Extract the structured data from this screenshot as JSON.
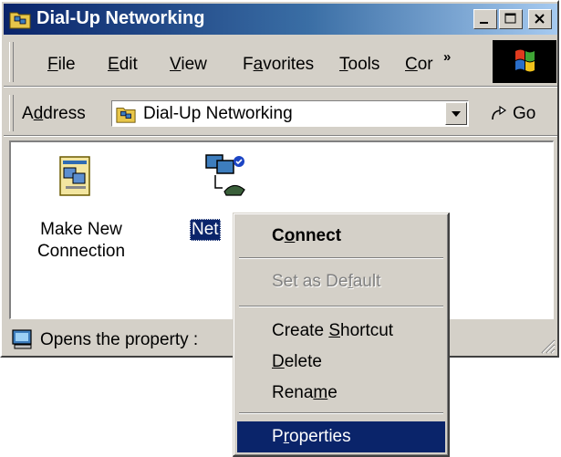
{
  "window": {
    "title": "Dial-Up Networking"
  },
  "menubar": {
    "items": [
      {
        "label": "File",
        "ul": "F",
        "rest": "ile"
      },
      {
        "label": "Edit",
        "ul": "E",
        "rest": "dit"
      },
      {
        "label": "View",
        "ul": "V",
        "rest": "iew"
      },
      {
        "label": "Favorites",
        "pre": "F",
        "ul": "a",
        "rest": "vorites"
      },
      {
        "label": "Tools",
        "ul": "T",
        "rest": "ools"
      },
      {
        "label": "Cor",
        "ul": "C",
        "rest": "or"
      }
    ],
    "chevron": "»"
  },
  "addressbar": {
    "label_pre": "A",
    "label_ul": "d",
    "label_rest": "dress",
    "value": "Dial-Up Networking",
    "go_label": "Go"
  },
  "content": {
    "items": [
      {
        "line1": "Make New",
        "line2": "Connection"
      },
      {
        "label": "Net"
      }
    ]
  },
  "statusbar": {
    "text": "Opens the property :"
  },
  "context_menu": {
    "connect": {
      "pre": "C",
      "ul": "o",
      "rest": "nnect"
    },
    "set_default": {
      "pre": "Set as De",
      "ul": "f",
      "rest": "ault"
    },
    "create_shortcut": {
      "pre": "Create ",
      "ul": "S",
      "rest": "hortcut"
    },
    "delete": {
      "pre": "",
      "ul": "D",
      "rest": "elete"
    },
    "rename": {
      "pre": "Rena",
      "ul": "m",
      "rest": "e"
    },
    "properties": {
      "pre": "P",
      "ul": "r",
      "rest": "operties"
    }
  },
  "colors": {
    "selection": "#0a246a",
    "titlebar_start": "#0a246a",
    "titlebar_end": "#a6caf0",
    "face": "#d4d0c8"
  }
}
